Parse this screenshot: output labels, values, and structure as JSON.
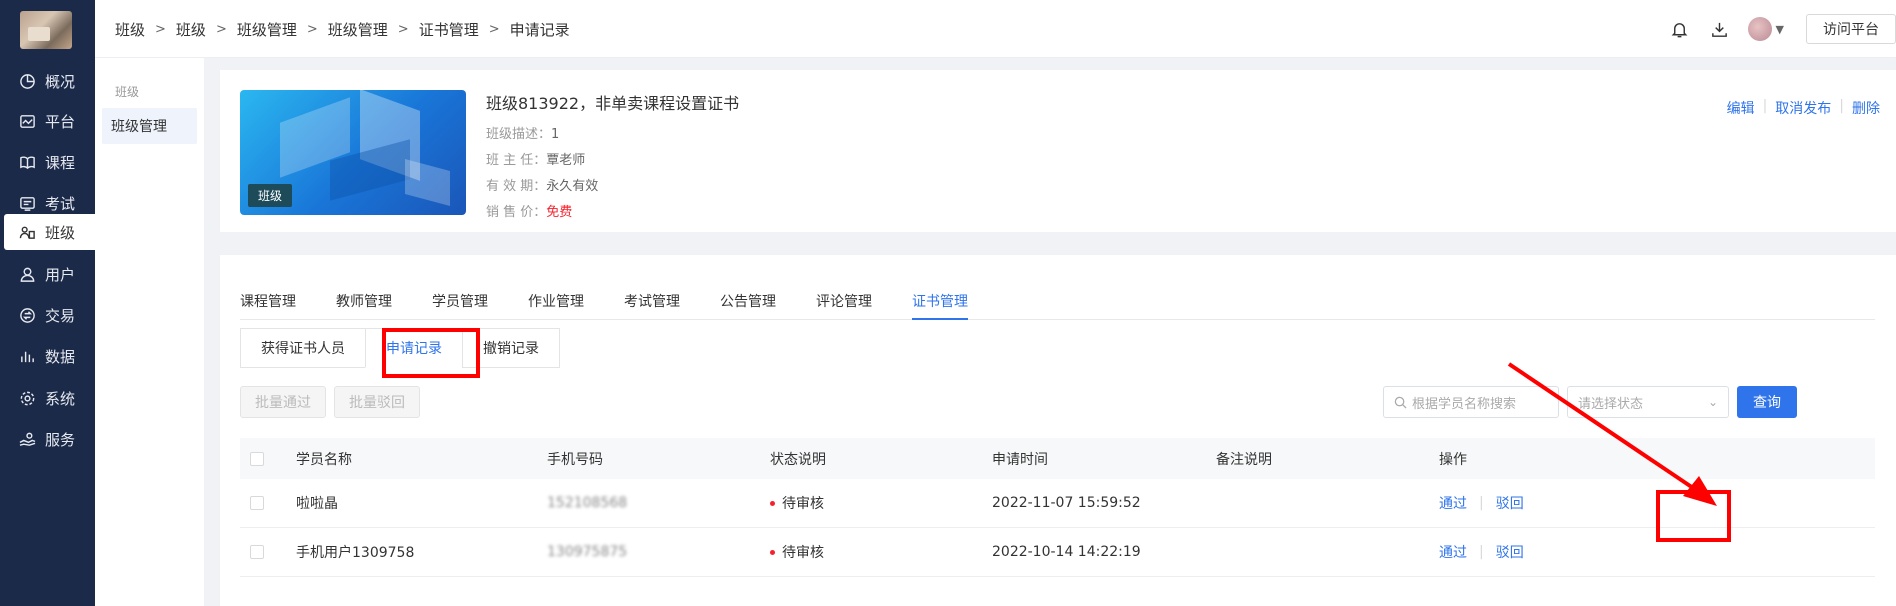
{
  "sidebar": {
    "items": [
      {
        "label": "概况",
        "icon": "pie-chart-icon"
      },
      {
        "label": "平台",
        "icon": "platform-icon"
      },
      {
        "label": "课程",
        "icon": "book-icon"
      },
      {
        "label": "考试",
        "icon": "exam-icon"
      },
      {
        "label": "班级",
        "icon": "class-icon"
      },
      {
        "label": "用户",
        "icon": "user-icon"
      },
      {
        "label": "交易",
        "icon": "trade-icon"
      },
      {
        "label": "数据",
        "icon": "data-icon"
      },
      {
        "label": "系统",
        "icon": "gear-icon"
      },
      {
        "label": "服务",
        "icon": "service-icon"
      }
    ],
    "active_index": 4
  },
  "subnav": {
    "group": "班级",
    "item": "班级管理"
  },
  "header": {
    "breadcrumb": [
      "班级",
      "班级",
      "班级管理",
      "班级管理",
      "证书管理",
      "申请记录"
    ],
    "visit_button": "访问平台"
  },
  "class_card": {
    "title": "班级813922，非单卖课程设置证书",
    "cover_tag": "班级",
    "rows": [
      {
        "label": "班级描述：",
        "value": "1"
      },
      {
        "label": "班 主 任：",
        "value": "覃老师"
      },
      {
        "label": "有 效 期：",
        "value": "永久有效"
      },
      {
        "label": "销 售 价：",
        "value": "免费"
      }
    ],
    "actions": [
      "编辑",
      "取消发布",
      "删除"
    ]
  },
  "tabs": [
    "课程管理",
    "教师管理",
    "学员管理",
    "作业管理",
    "考试管理",
    "公告管理",
    "评论管理",
    "证书管理"
  ],
  "active_tab": "证书管理",
  "subtabs": [
    "获得证书人员",
    "申请记录",
    "撤销记录"
  ],
  "toolbar": {
    "batch_pass": "批量通过",
    "batch_reject": "批量驳回",
    "search_placeholder": "根据学员名称搜索",
    "status_placeholder": "请选择状态",
    "query": "查询"
  },
  "table": {
    "columns": [
      "学员名称",
      "手机号码",
      "状态说明",
      "申请时间",
      "备注说明",
      "操作"
    ],
    "rows": [
      {
        "name": "啦啦晶",
        "phone": "152108568",
        "status": "待审核",
        "time": "2022-11-07 15:59:52",
        "note": "",
        "actions": [
          "通过",
          "驳回"
        ]
      },
      {
        "name": "手机用户1309758",
        "phone": "130975875",
        "status": "待审核",
        "time": "2022-10-14 14:22:19",
        "note": "",
        "actions": [
          "通过",
          "驳回"
        ]
      }
    ]
  },
  "colors": {
    "accent": "#2f74eb",
    "sidebar_bg": "#1c2a49",
    "highlight": "#ff0000",
    "status_dot": "#f5222d"
  }
}
